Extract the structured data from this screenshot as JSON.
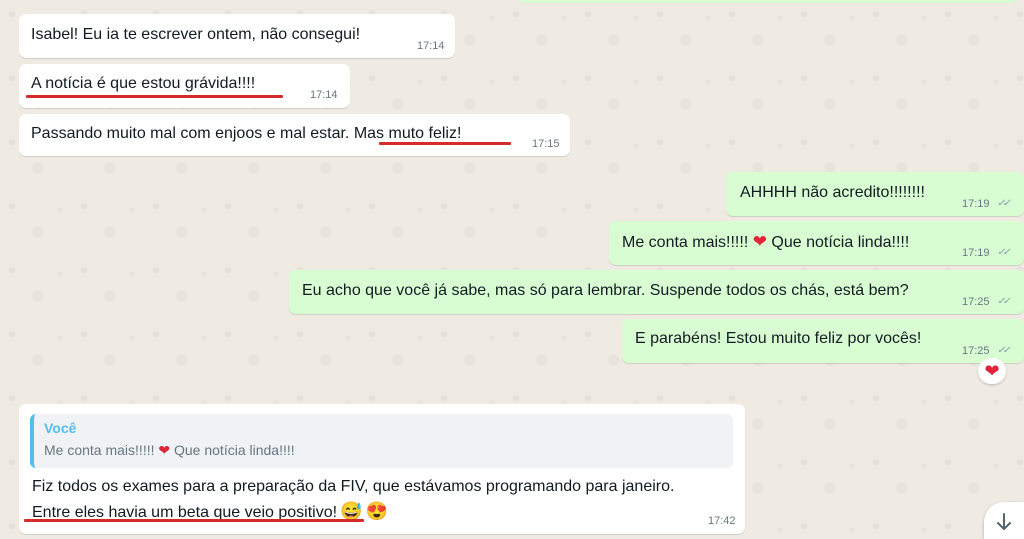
{
  "messages": [
    {
      "id": "m1",
      "direction": "incoming",
      "text": "Isabel! Eu ia te escrever ontem, não consegui!",
      "time": "17:14"
    },
    {
      "id": "m2",
      "direction": "incoming",
      "text": "A notícia é que estou grávida!!!!",
      "time": "17:14"
    },
    {
      "id": "m3",
      "direction": "incoming",
      "text_part1": "Passando muito mal com enjoos e mal estar. ",
      "text_part2": "Mas muto feliz!",
      "time": "17:15"
    },
    {
      "id": "m4",
      "direction": "outgoing",
      "text": "AHHHH não acredito!!!!!!!!",
      "time": "17:19",
      "ticks": "read-ticks-icon"
    },
    {
      "id": "m5",
      "direction": "outgoing",
      "text_part1": "Me conta mais!!!!! ",
      "text_part2": " Que notícia linda!!!!",
      "emoji": "red-heart",
      "time": "17:19",
      "ticks": "read-ticks-icon"
    },
    {
      "id": "m6",
      "direction": "outgoing",
      "text": "Eu acho que você já sabe, mas só para lembrar. Suspende todos os chás, está bem?",
      "time": "17:25",
      "ticks": "read-ticks-icon"
    },
    {
      "id": "m7",
      "direction": "outgoing",
      "text": "E parabéns! Estou muito feliz por vocês!",
      "time": "17:25",
      "ticks": "read-ticks-icon",
      "reaction": "red-heart"
    },
    {
      "id": "m8",
      "direction": "incoming",
      "quote": {
        "author": "Você",
        "text_part1": "Me conta mais!!!!! ",
        "text_part2": " Que notícia linda!!!!"
      },
      "line1": "Fiz todos os exames para a preparação da FIV, que estávamos programando para janeiro.",
      "line2": "Entre eles havia um beta que veio positivo!",
      "emojis": [
        "grinning-sweat-emoji",
        "heart-eyes-emoji"
      ],
      "time": "17:42"
    }
  ],
  "glyphs": {
    "heart": "❤",
    "ticks": "✓✓",
    "sweat_smile": "😅",
    "heart_eyes": "😍"
  },
  "colors": {
    "incoming": "#ffffff",
    "outgoing": "#d9fdd3",
    "highlight_underline": "#d52b2b",
    "quote_accent": "#53bdeb"
  }
}
